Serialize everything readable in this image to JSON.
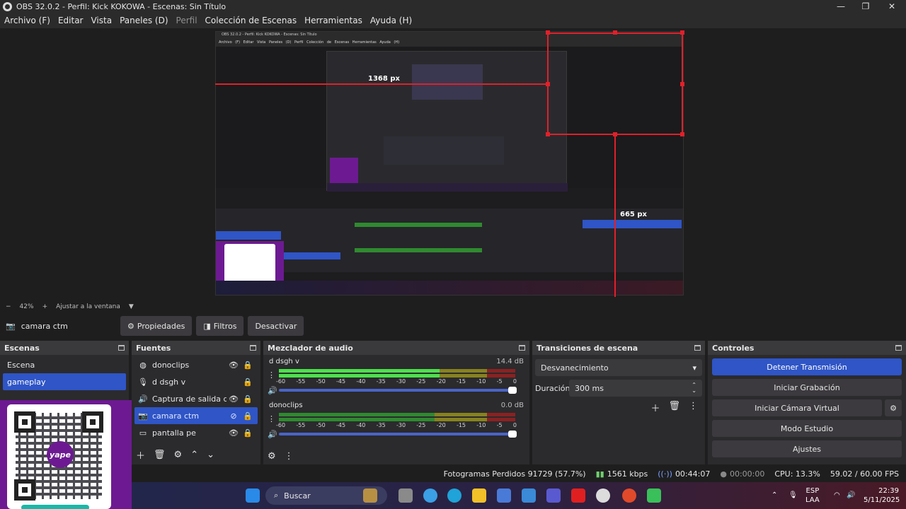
{
  "window": {
    "title": "OBS 32.0.2 - Perfil: Kick KOKOWA - Escenas: Sin Título",
    "min": "—",
    "max": "❐",
    "close": "✕"
  },
  "menu": [
    "Archivo (F)",
    "Editar",
    "Vista",
    "Paneles (D)",
    "Perfil",
    "Colección de Escenas",
    "Herramientas",
    "Ayuda (H)"
  ],
  "preview": {
    "nested_title": "OBS 32.0.2 - Perfil: Kick KOKOWA - Escenas: Sin Título",
    "nested_menu": "Archivo (F)  Editar  Vista  Paneles (D)  Perfil  Colección de Escenas  Herramientas  Ayuda (H)",
    "label_width": "1368 px",
    "label_height": "665 px"
  },
  "zoom": {
    "minus": "−",
    "value": "42%",
    "plus": "+",
    "fit": "Ajustar a la ventana",
    "arrow": "▼"
  },
  "source_toolbar": {
    "name": "camara ctm",
    "properties": "Propiedades",
    "filters": "Filtros",
    "deactivate": "Desactivar"
  },
  "scenes": {
    "title": "Escenas",
    "items": [
      "Escena",
      "gameplay"
    ]
  },
  "sources": {
    "title": "Fuentes",
    "items": [
      {
        "label": "donoclips",
        "icon": "globe-icon"
      },
      {
        "label": "d dsgh v",
        "icon": "microphone-icon"
      },
      {
        "label": "Captura de salida de a",
        "icon": "speaker-icon"
      },
      {
        "label": "camara ctm",
        "icon": "camera-icon"
      },
      {
        "label": "pantalla pe",
        "icon": "monitor-icon"
      }
    ]
  },
  "mixer": {
    "title": "Mezclador de audio",
    "ticks": [
      "-60",
      "-55",
      "-50",
      "-45",
      "-40",
      "-35",
      "-30",
      "-25",
      "-20",
      "-15",
      "-10",
      "-5",
      "0"
    ],
    "channels": [
      {
        "name": "d dsgh v",
        "db": "14.4 dB",
        "level": 0.68
      },
      {
        "name": "donoclips",
        "db": "0.0 dB",
        "level": 0
      }
    ]
  },
  "transitions": {
    "title": "Transiciones de escena",
    "selected": "Desvanecimiento",
    "duration_label": "Duración",
    "duration_value": "300 ms"
  },
  "controls": {
    "title": "Controles",
    "buttons": [
      "Detener Transmisión",
      "Iniciar Grabación",
      "Iniciar Cámara Virtual",
      "Modo Estudio",
      "Ajustes"
    ]
  },
  "status": {
    "dropped": "Fotogramas Perdidos 91729 (57.7%)",
    "bitrate": "1561 kbps",
    "stream_time": "00:44:07",
    "rec_time": "00:00:00",
    "cpu": "CPU: 13.3%",
    "fps": "59.02 / 60.00 FPS"
  },
  "qr_overlay": {
    "logo_text": "yape"
  },
  "taskbar": {
    "search": "Buscar",
    "lang_top": "ESP",
    "lang_bottom": "LAA",
    "time": "22:39",
    "date": "5/11/2025"
  }
}
